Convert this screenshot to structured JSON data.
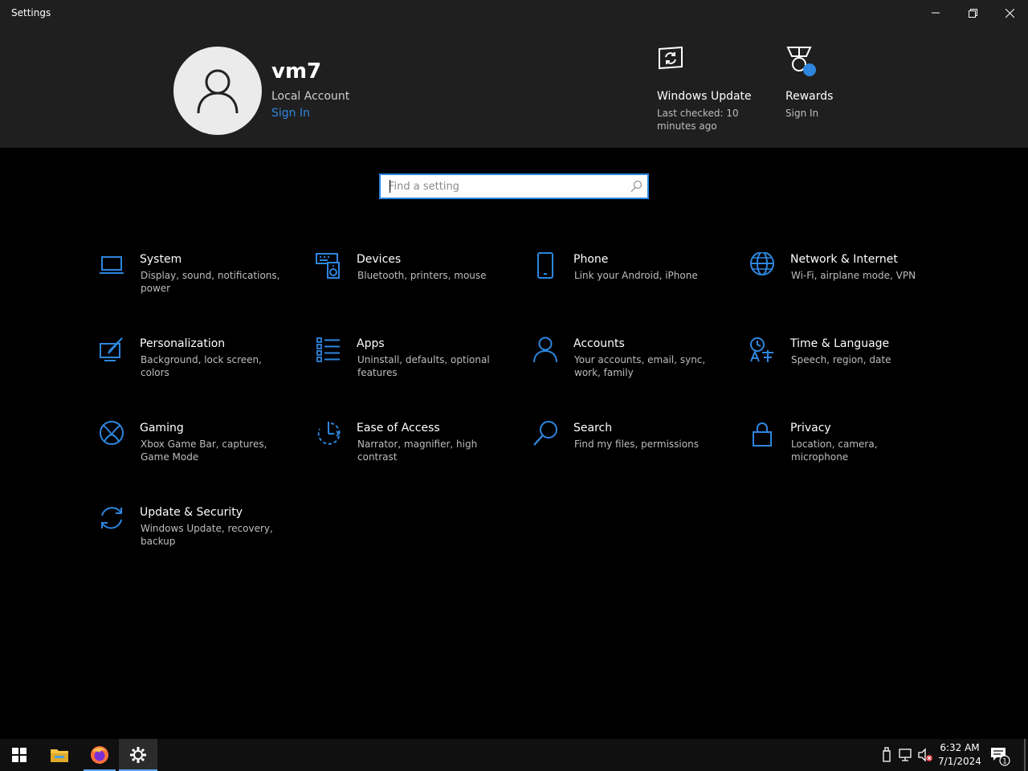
{
  "window": {
    "title": "Settings"
  },
  "user": {
    "name": "vm7",
    "account_type": "Local Account",
    "sign_in": "Sign In"
  },
  "quick_links": [
    {
      "title": "Windows Update",
      "subtitle": "Last checked: 10 minutes ago",
      "icon": "windows-update-icon"
    },
    {
      "title": "Rewards",
      "subtitle": "Sign In",
      "icon": "rewards-medal-icon"
    }
  ],
  "search": {
    "placeholder": "Find a setting",
    "value": ""
  },
  "categories": [
    {
      "title": "System",
      "description": "Display, sound, notifications, power",
      "icon": "laptop-icon"
    },
    {
      "title": "Devices",
      "description": "Bluetooth, printers, mouse",
      "icon": "keyboard-speaker-icon"
    },
    {
      "title": "Phone",
      "description": "Link your Android, iPhone",
      "icon": "phone-icon"
    },
    {
      "title": "Network & Internet",
      "description": "Wi-Fi, airplane mode, VPN",
      "icon": "globe-icon"
    },
    {
      "title": "Personalization",
      "description": "Background, lock screen, colors",
      "icon": "paint-screen-icon"
    },
    {
      "title": "Apps",
      "description": "Uninstall, defaults, optional features",
      "icon": "apps-list-icon"
    },
    {
      "title": "Accounts",
      "description": "Your accounts, email, sync, work, family",
      "icon": "person-icon"
    },
    {
      "title": "Time & Language",
      "description": "Speech, region, date",
      "icon": "time-language-icon"
    },
    {
      "title": "Gaming",
      "description": "Xbox Game Bar, captures, Game Mode",
      "icon": "xbox-icon"
    },
    {
      "title": "Ease of Access",
      "description": "Narrator, magnifier, high contrast",
      "icon": "ease-of-access-icon"
    },
    {
      "title": "Search",
      "description": "Find my files, permissions",
      "icon": "search-magnifier-icon"
    },
    {
      "title": "Privacy",
      "description": "Location, camera, microphone",
      "icon": "lock-icon"
    },
    {
      "title": "Update & Security",
      "description": "Windows Update, recovery, backup",
      "icon": "sync-arrows-icon"
    }
  ],
  "taskbar": {
    "apps": [
      "start-icon",
      "file-explorer-icon",
      "firefox-icon",
      "settings-gear-icon"
    ],
    "time": "6:32 AM",
    "date": "7/1/2024",
    "notification_count": "1"
  },
  "colors": {
    "accent": "#2e86de",
    "header_bg": "#1f1f1f",
    "body_bg": "#000000",
    "taskbar_bg": "#101010"
  }
}
